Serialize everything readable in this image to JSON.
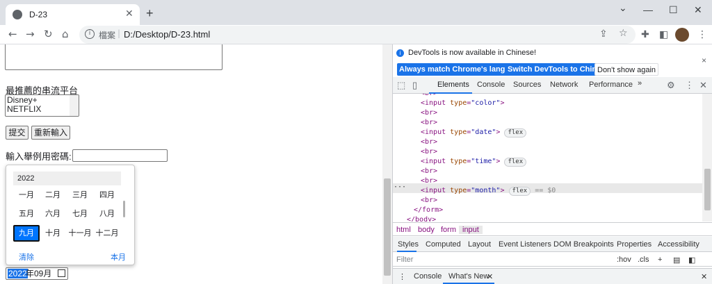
{
  "browser": {
    "tab_title": "D-23",
    "tab_close": "✕",
    "new_tab": "+",
    "minimize": "—",
    "maximize": "☐",
    "close": "✕",
    "back": "←",
    "forward": "→",
    "reload": "↻",
    "home": "⌂",
    "info": "i",
    "scheme_label": "檔案",
    "url": "D:/Desktop/D-23.html",
    "menu": "⋮"
  },
  "page": {
    "streaming_label": "最推薦的串流平台",
    "listbox_options": [
      "Disney+",
      "NETFLIX"
    ],
    "submit_label": "提交",
    "reset_label": "重新輸入",
    "password_label": "輸入舉例用密碼:",
    "picker": {
      "year": "2022",
      "months": [
        "一月",
        "二月",
        "三月",
        "四月",
        "五月",
        "六月",
        "七月",
        "八月",
        "九月",
        "十月",
        "十一月",
        "十二月"
      ],
      "selected_month": "九月",
      "clear": "清除",
      "this_month": "本月"
    },
    "month_input": {
      "year": "2022",
      "rest": "年09月"
    }
  },
  "devtools": {
    "notice": "DevTools is now available in Chinese!",
    "btn_match": "Always match Chrome's language",
    "btn_switch": "Switch DevTools to Chinese",
    "btn_dont": "Don't show again",
    "close": "×",
    "tabs": [
      "Elements",
      "Console",
      "Sources",
      "Network",
      "Performance"
    ],
    "more_tabs": "»",
    "code_lines": [
      {
        "type": "br_partial"
      },
      {
        "type": "input",
        "t": "color"
      },
      {
        "type": "br"
      },
      {
        "type": "br"
      },
      {
        "type": "input",
        "t": "date",
        "pill": "flex"
      },
      {
        "type": "br"
      },
      {
        "type": "br"
      },
      {
        "type": "input",
        "t": "time",
        "pill": "flex"
      },
      {
        "type": "br"
      },
      {
        "type": "br"
      },
      {
        "type": "input",
        "t": "month",
        "pill": "flex",
        "selected": true
      },
      {
        "type": "br"
      },
      {
        "type": "close",
        "text": "</form>"
      },
      {
        "type": "close",
        "text": "</body>"
      }
    ],
    "dollar0": "== $0",
    "ellipsis": "···",
    "breadcrumb": [
      "html",
      "body",
      "form",
      "input"
    ],
    "style_tabs": [
      "Styles",
      "Computed",
      "Layout",
      "Event Listeners",
      "DOM Breakpoints",
      "Properties",
      "Accessibility"
    ],
    "filter_placeholder": "Filter",
    "hov": ":hov",
    "cls": ".cls",
    "plus": "+",
    "drawer_tabs": [
      "Console",
      "What's New"
    ],
    "drawer_close": "✕"
  }
}
